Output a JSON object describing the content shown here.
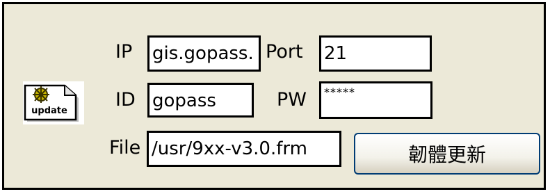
{
  "form": {
    "ip_label": "IP",
    "ip_value": "gis.gopass.",
    "port_label": "Port",
    "port_value": "21",
    "id_label": "ID",
    "id_value": "gopass",
    "pw_label": "PW",
    "pw_value": "*****",
    "file_label": "File",
    "file_value": "/usr/9xx-v3.0.frm",
    "update_button_label": "韌體更新"
  },
  "icon": {
    "name": "update-icon",
    "text": "update"
  }
}
